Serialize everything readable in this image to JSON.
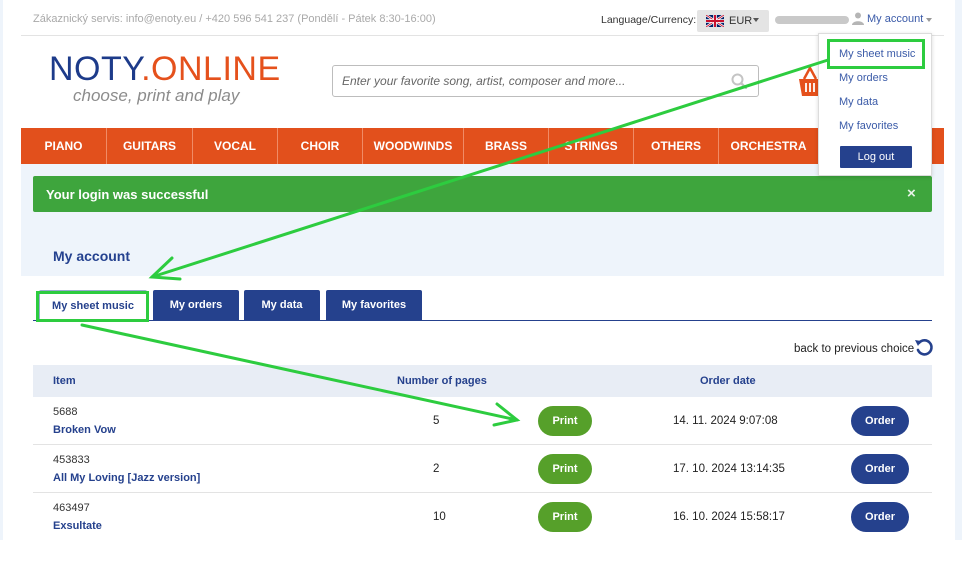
{
  "topbar": {
    "support": "Zákaznický servis: info@enoty.eu / +420 596 541 237 (Pondělí - Pátek 8:30-16:00)",
    "language_label": "Language/Currency:",
    "currency": "EUR",
    "account_label": "My account"
  },
  "header": {
    "logo_part1": "NOTY",
    "logo_dot": ".",
    "logo_part2": "ONLINE",
    "tagline": "choose, print and play",
    "search_placeholder": "Enter your favorite song, artist, composer and more..."
  },
  "nav": {
    "items": [
      "PIANO",
      "GUITARS",
      "VOCAL",
      "CHOIR",
      "WOODWINDS",
      "BRASS",
      "STRINGS",
      "OTHERS",
      "ORCHESTRA"
    ]
  },
  "dropdown": {
    "items": [
      "My sheet music",
      "My orders",
      "My data",
      "My favorites"
    ],
    "logout": "Log out"
  },
  "alert": {
    "message": "Your login was successful",
    "close": "×"
  },
  "account": {
    "title": "My account",
    "tabs": [
      "My sheet music",
      "My orders",
      "My data",
      "My favorites"
    ],
    "back_label": "back to previous choice",
    "columns": [
      "Item",
      "Number of pages",
      "Order date"
    ],
    "rows": [
      {
        "id": "5688",
        "title": "Broken Vow",
        "pages": "5",
        "print": "Print",
        "date": "14. 11. 2024 9:07:08",
        "order": "Order"
      },
      {
        "id": "453833",
        "title": "All My Loving [Jazz version]",
        "pages": "2",
        "print": "Print",
        "date": "17. 10. 2024 13:14:35",
        "order": "Order"
      },
      {
        "id": "463497",
        "title": "Exsultate",
        "pages": "10",
        "print": "Print",
        "date": "16. 10. 2024 15:58:17",
        "order": "Order"
      }
    ]
  },
  "colors": {
    "brand_blue": "#1d3b8a",
    "brand_orange": "#e2501c",
    "success_green": "#3ea53d",
    "annotation_green": "#2dcc3f"
  }
}
